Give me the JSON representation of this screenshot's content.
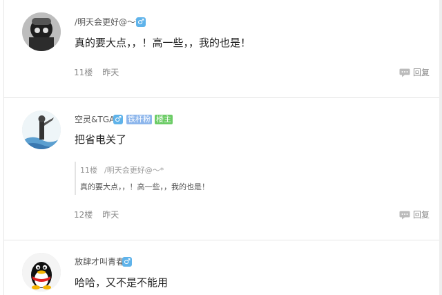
{
  "posts": [
    {
      "username": "/明天会更好@～*",
      "gender": "♂",
      "content": "真的要大点，，！高一些，，我的也是！",
      "floor": "11楼",
      "time": "昨天",
      "reply_label": "回复"
    },
    {
      "username": "空灵&TGA",
      "gender": "♂",
      "badges": [
        "铁杆粉",
        "楼主"
      ],
      "content": "把省电关了",
      "quote": {
        "floor": "11楼",
        "username": "/明天会更好@～*",
        "text": "真的要大点，，！高一些，，我的也是！"
      },
      "floor": "12楼",
      "time": "昨天",
      "reply_label": "回复"
    },
    {
      "username": "放肆才叫青春",
      "gender": "♂",
      "content": "哈哈，又不是不能用"
    }
  ],
  "colors": {
    "gender_badge": "#5fb3ea",
    "fan_badge": "#8db6ec",
    "owner_badge": "#6ccc66"
  },
  "icons": {
    "reply": "speech-bubble-icon"
  }
}
